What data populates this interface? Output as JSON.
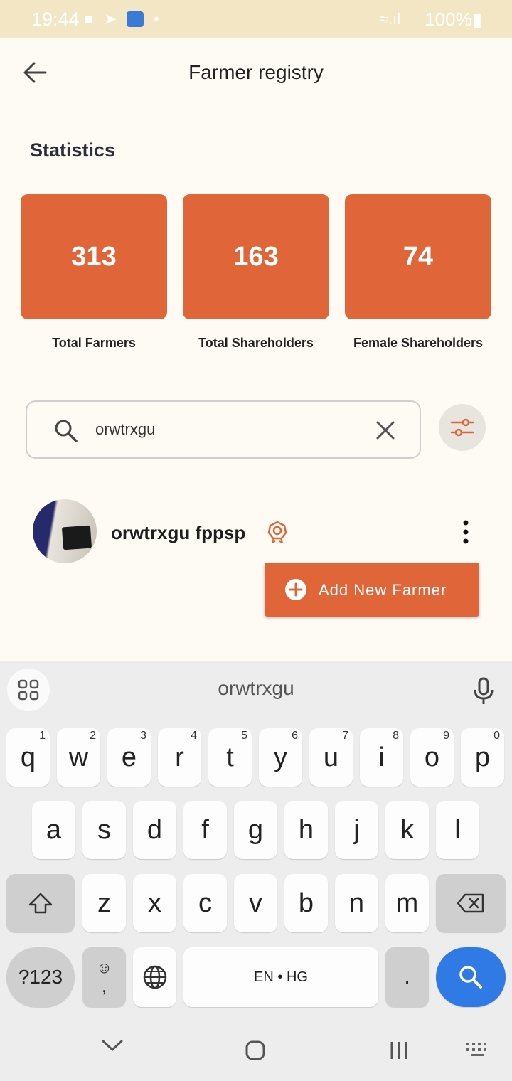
{
  "status_bar": {
    "time": "19:44",
    "battery": "100%"
  },
  "header": {
    "title": "Farmer registry"
  },
  "statistics": {
    "section_title": "Statistics",
    "cards": [
      {
        "value": "313",
        "label": "Total Farmers"
      },
      {
        "value": "163",
        "label": "Total Shareholders"
      },
      {
        "value": "74",
        "label": "Female Shareholders"
      }
    ]
  },
  "search": {
    "value": "orwtrxgu"
  },
  "farmers": [
    {
      "name": "orwtrxgu fppsp"
    }
  ],
  "add_button": {
    "label": "Add New Farmer"
  },
  "keyboard": {
    "suggestion": "orwtrxgu",
    "row1": [
      {
        "k": "q",
        "h": "1"
      },
      {
        "k": "w",
        "h": "2"
      },
      {
        "k": "e",
        "h": "3"
      },
      {
        "k": "r",
        "h": "4"
      },
      {
        "k": "t",
        "h": "5"
      },
      {
        "k": "y",
        "h": "6"
      },
      {
        "k": "u",
        "h": "7"
      },
      {
        "k": "i",
        "h": "8"
      },
      {
        "k": "o",
        "h": "9"
      },
      {
        "k": "p",
        "h": "0"
      }
    ],
    "row2": [
      "a",
      "s",
      "d",
      "f",
      "g",
      "h",
      "j",
      "k",
      "l"
    ],
    "row3": [
      "z",
      "x",
      "c",
      "v",
      "b",
      "n",
      "m"
    ],
    "symbols_key": "?123",
    "comma_key": ",",
    "space_label": "EN • HG",
    "period_key": "."
  },
  "colors": {
    "accent": "#e0663a",
    "status_bar": "#f3e6c4",
    "background": "#fdfbf4",
    "search_key": "#2f7ae5"
  }
}
